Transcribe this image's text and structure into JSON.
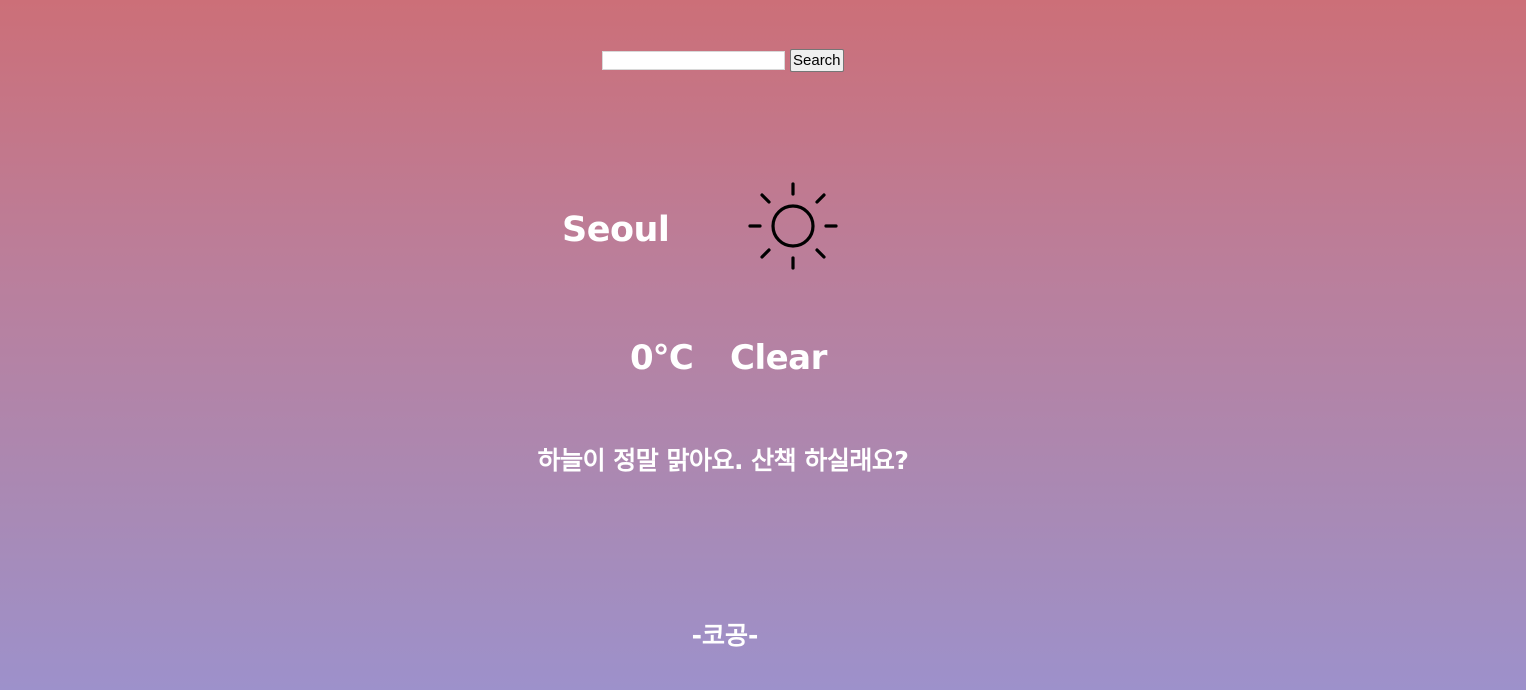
{
  "search": {
    "value": "",
    "placeholder": "",
    "button_label": "Search"
  },
  "weather": {
    "city": "Seoul",
    "icon": "sun-icon",
    "temperature": "0℃",
    "condition": "Clear",
    "message": "하늘이 정말 맑아요. 산책 하실래요?"
  },
  "footer": {
    "text": "-코공-"
  },
  "colors": {
    "gradient_top": "#cc6f78",
    "gradient_bottom": "#9d91cb",
    "text": "#ffffff",
    "icon_stroke": "#000000"
  }
}
